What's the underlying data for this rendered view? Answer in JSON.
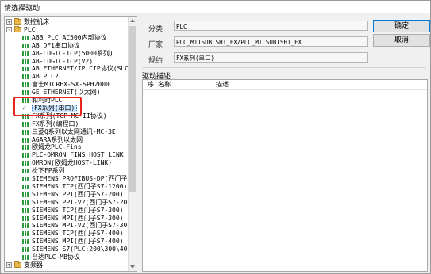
{
  "window": {
    "title": "请选择驱动"
  },
  "tree": {
    "rows": [
      {
        "kind": "folder",
        "expander": "+",
        "label": "数控机床"
      },
      {
        "kind": "folder",
        "expander": "-",
        "label": "PLC"
      },
      {
        "kind": "driver",
        "label": "ABB PLC AC500内部协议"
      },
      {
        "kind": "driver",
        "label": "AB DF1串口协议"
      },
      {
        "kind": "driver",
        "label": "AB-LOGIC-TCP(5000系列)"
      },
      {
        "kind": "driver",
        "label": "AB-LOGIC-TCP(V2)"
      },
      {
        "kind": "driver",
        "label": "AB ETHERNET/IP CIP协议(SLC5"
      },
      {
        "kind": "driver",
        "label": "AB PLC2"
      },
      {
        "kind": "driver",
        "label": "富士MICREX-SX-SPH2000"
      },
      {
        "kind": "driver",
        "label": "GE ETHERNET(以太网)"
      },
      {
        "kind": "driver",
        "label": "和利时PLC"
      },
      {
        "kind": "selected",
        "label": "FX系列(串口)"
      },
      {
        "kind": "driver",
        "label": "FX系列(TCP-MC-II协议)"
      },
      {
        "kind": "driver",
        "label": "FX系列(编程口)"
      },
      {
        "kind": "driver",
        "label": "三菱Q系列以太网通讯-MC-3E"
      },
      {
        "kind": "driver",
        "label": "AGARA系列以太网"
      },
      {
        "kind": "driver",
        "label": "欧姆龙PLC-Fins"
      },
      {
        "kind": "driver",
        "label": "PLC-OMRON_FINS_HOST_LINK"
      },
      {
        "kind": "driver",
        "label": "OMRON(欧姆龙HOST-LINK)"
      },
      {
        "kind": "driver",
        "label": "松下FP系列"
      },
      {
        "kind": "driver",
        "label": "SIEMENS PROFIBUS-DP(西门子)"
      },
      {
        "kind": "driver",
        "label": "SIEMENS TCP(西门子S7-1200)"
      },
      {
        "kind": "driver",
        "label": "SIEMENS PPI(西门子S7-200)"
      },
      {
        "kind": "driver",
        "label": "SIEMENS PPI-V2(西门子S7-200"
      },
      {
        "kind": "driver",
        "label": "SIEMENS TCP(西门子S7-300)"
      },
      {
        "kind": "driver",
        "label": "SIEMENS MPI(西门子S7-300)"
      },
      {
        "kind": "driver",
        "label": "SIEMENS MPI-V2(西门子S7-300"
      },
      {
        "kind": "driver",
        "label": "SIEMENS TCP(西门子S7-400)"
      },
      {
        "kind": "driver",
        "label": "SIEMENS MPI(西门子S7-400)"
      },
      {
        "kind": "driver",
        "label": "SIEMENS S7(PLC:200\\300\\400\\"
      },
      {
        "kind": "driver",
        "label": "台达PLC-MB协议"
      },
      {
        "kind": "folder",
        "expander": "+",
        "label": "变频器"
      }
    ]
  },
  "details": {
    "category_label": "分类:",
    "category_value": "PLC",
    "vendor_label": "厂家:",
    "vendor_value": "PLC_MITSUBISHI_FX/PLC_MITSUBISHI_FX",
    "spec_label": "规约:",
    "spec_value": "FX系列(串口)"
  },
  "buttons": {
    "ok": "确定",
    "cancel": "取消"
  },
  "description": {
    "title": "驱动描述",
    "columns": [
      "序. 名称",
      "描述"
    ]
  },
  "colors": {
    "highlight_box": "#e8241c",
    "selection": "#cde6ff",
    "driver_icon": "#2e9b3c",
    "folder_icon": "#e8b84a"
  }
}
